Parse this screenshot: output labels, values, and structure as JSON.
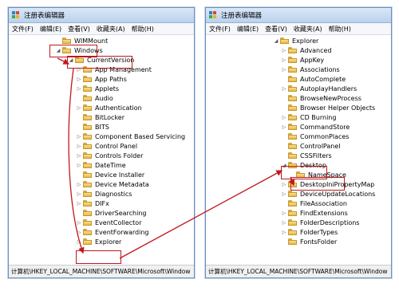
{
  "left_window": {
    "title": "注册表编辑器",
    "menu": [
      "文件(F)",
      "编辑(E)",
      "查看(V)",
      "收藏夹(A)",
      "帮助(H)"
    ],
    "tree": [
      {
        "label": "WIMMount",
        "expander": ""
      },
      {
        "label": "Windows",
        "expander": "◢"
      },
      {
        "label": "CurrentVersion",
        "expander": "◢"
      },
      {
        "label": "App Management",
        "expander": "▷"
      },
      {
        "label": "App Paths",
        "expander": "▷"
      },
      {
        "label": "Applets",
        "expander": "▷"
      },
      {
        "label": "Audio",
        "expander": ""
      },
      {
        "label": "Authentication",
        "expander": "▷"
      },
      {
        "label": "BitLocker",
        "expander": ""
      },
      {
        "label": "BITS",
        "expander": ""
      },
      {
        "label": "Component Based Servicing",
        "expander": "▷"
      },
      {
        "label": "Control Panel",
        "expander": "▷"
      },
      {
        "label": "Controls Folder",
        "expander": "▷"
      },
      {
        "label": "DateTime",
        "expander": "▷"
      },
      {
        "label": "Device Installer",
        "expander": ""
      },
      {
        "label": "Device Metadata",
        "expander": "▷"
      },
      {
        "label": "Diagnostics",
        "expander": "▷"
      },
      {
        "label": "DIFx",
        "expander": "▷"
      },
      {
        "label": "DriverSearching",
        "expander": ""
      },
      {
        "label": "EventCollector",
        "expander": "▷"
      },
      {
        "label": "EventForwarding",
        "expander": "▷"
      },
      {
        "label": "Explorer",
        "expander": "▷"
      }
    ],
    "status": "计算机\\HKEY_LOCAL_MACHINE\\SOFTWARE\\Microsoft\\Window"
  },
  "right_window": {
    "title": "注册表编辑器",
    "menu": [
      "文件(F)",
      "编辑(E)",
      "查看(V)",
      "收藏夹(A)",
      "帮助(H)"
    ],
    "tree": [
      {
        "label": "Explorer",
        "expander": "◢"
      },
      {
        "label": "Advanced",
        "expander": "▷"
      },
      {
        "label": "AppKey",
        "expander": "▷"
      },
      {
        "label": "Associations",
        "expander": "▷"
      },
      {
        "label": "AutoComplete",
        "expander": ""
      },
      {
        "label": "AutoplayHandlers",
        "expander": "▷"
      },
      {
        "label": "BrowseNewProcess",
        "expander": ""
      },
      {
        "label": "Browser Helper Objects",
        "expander": ""
      },
      {
        "label": "CD Burning",
        "expander": "▷"
      },
      {
        "label": "CommandStore",
        "expander": "▷"
      },
      {
        "label": "CommonPlaces",
        "expander": ""
      },
      {
        "label": "ControlPanel",
        "expander": ""
      },
      {
        "label": "CSSFilters",
        "expander": ""
      },
      {
        "label": "Desktop",
        "expander": "◢"
      },
      {
        "label": "NameSpace",
        "expander": ""
      },
      {
        "label": "DesktopIniPropertyMap",
        "expander": "▷"
      },
      {
        "label": "DeviceUpdateLocations",
        "expander": "▷"
      },
      {
        "label": "FileAssociation",
        "expander": ""
      },
      {
        "label": "FindExtensions",
        "expander": "▷"
      },
      {
        "label": "FolderDescriptions",
        "expander": "▷"
      },
      {
        "label": "FolderTypes",
        "expander": "▷"
      },
      {
        "label": "FontsFolder",
        "expander": ""
      }
    ],
    "status": "计算机\\HKEY_LOCAL_MACHINE\\SOFTWARE\\Microsoft\\Window"
  },
  "colors": {
    "highlight": "#c0181d",
    "folder": "#e5b94c"
  }
}
